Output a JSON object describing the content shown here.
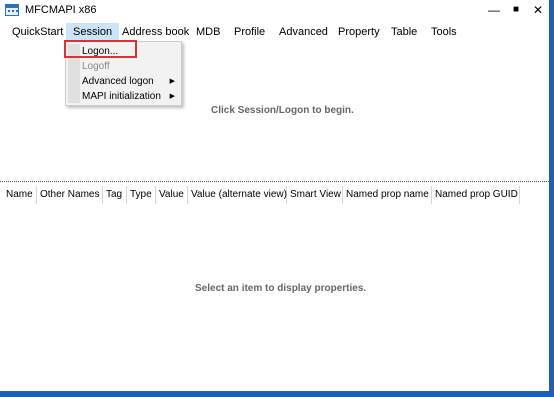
{
  "window": {
    "title": "MFCMAPI x86"
  },
  "controls": {
    "minimize": "—",
    "maximize": "■",
    "close": "✕"
  },
  "menubar": {
    "items": [
      {
        "label": "QuickStart"
      },
      {
        "label": "Session"
      },
      {
        "label": "Address book"
      },
      {
        "label": "MDB"
      },
      {
        "label": "Profile"
      },
      {
        "label": "Advanced"
      },
      {
        "label": "Property"
      },
      {
        "label": "Table"
      },
      {
        "label": "Tools"
      }
    ],
    "active": "Session"
  },
  "session_menu": {
    "items": [
      {
        "label": "Logon...",
        "enabled": true,
        "submenu": false
      },
      {
        "label": "Logoff",
        "enabled": false,
        "submenu": false
      },
      {
        "label": "Advanced logon",
        "enabled": true,
        "submenu": true
      },
      {
        "label": "MAPI initialization",
        "enabled": true,
        "submenu": true
      }
    ],
    "highlighted": "Logon..."
  },
  "top_pane": {
    "hint": "Click Session/Logon to begin."
  },
  "property_pane": {
    "columns": [
      "Name",
      "Other Names",
      "Tag",
      "Type",
      "Value",
      "Value (alternate view)",
      "Smart View",
      "Named prop name",
      "Named prop GUID"
    ],
    "hint": "Select an item to display properties."
  },
  "colors": {
    "accent": "#1e5fb5",
    "highlight_border": "#e03030",
    "menu_active": "#cce4f7"
  }
}
